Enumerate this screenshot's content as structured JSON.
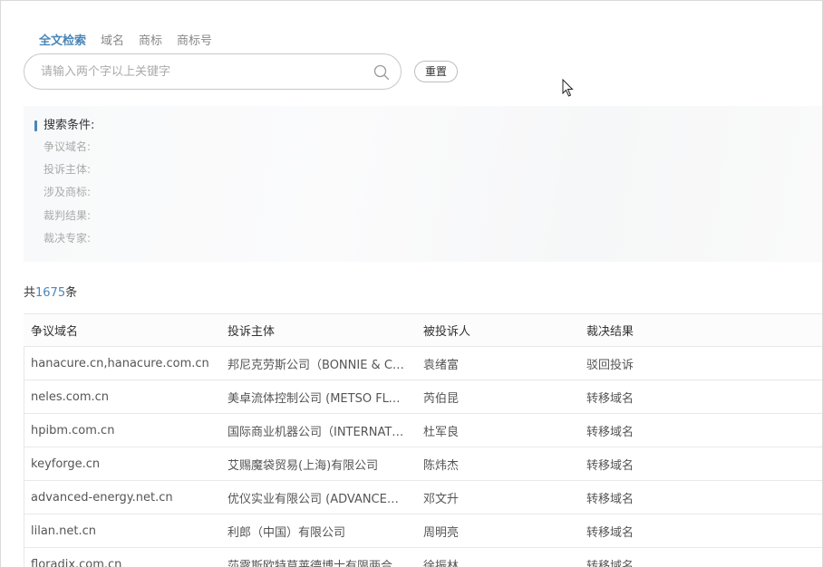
{
  "tabs": [
    {
      "label": "全文检索",
      "active": true
    },
    {
      "label": "域名",
      "active": false
    },
    {
      "label": "商标",
      "active": false
    },
    {
      "label": "商标号",
      "active": false
    }
  ],
  "search": {
    "placeholder": "请输入两个字以上关键字",
    "value": "",
    "icon": "search-icon"
  },
  "reset_label": "重置",
  "conditions": {
    "title": "搜索条件:",
    "rows": [
      "争议域名:",
      "投诉主体:",
      "涉及商标:",
      "裁判结果:",
      "裁决专家:"
    ]
  },
  "total": {
    "prefix": "共",
    "count": "1675",
    "suffix": "条"
  },
  "table": {
    "headers": [
      "争议域名",
      "投诉主体",
      "被投诉人",
      "裁决结果"
    ],
    "rows": [
      [
        "hanacure.cn,hanacure.com.cn",
        "邦尼克劳斯公司（BONNIE & CLYDE）",
        "袁绪富",
        "驳回投诉"
      ],
      [
        "neles.com.cn",
        "美卓流体控制公司 (METSO FLOW CONTROL)",
        "芮伯昆",
        "转移域名"
      ],
      [
        "hpibm.com.cn",
        "国际商业机器公司（INTERNATIONAL）",
        "杜军良",
        "转移域名"
      ],
      [
        "keyforge.cn",
        "艾赐魔袋贸易(上海)有限公司",
        "陈炜杰",
        "转移域名"
      ],
      [
        "advanced-energy.net.cn",
        "优仪实业有限公司 (ADVANCED ENERGY)",
        "邓文升",
        "转移域名"
      ],
      [
        "lilan.net.cn",
        "利郎（中国）有限公司",
        "周明亮",
        "转移域名"
      ],
      [
        "floradix.com.cn",
        "莎露斯欧特草莱德博士有限两合公司",
        "徐振林",
        "转移域名"
      ]
    ]
  },
  "colors": {
    "accent": "#4a86b6",
    "border": "#d9d9d9"
  }
}
